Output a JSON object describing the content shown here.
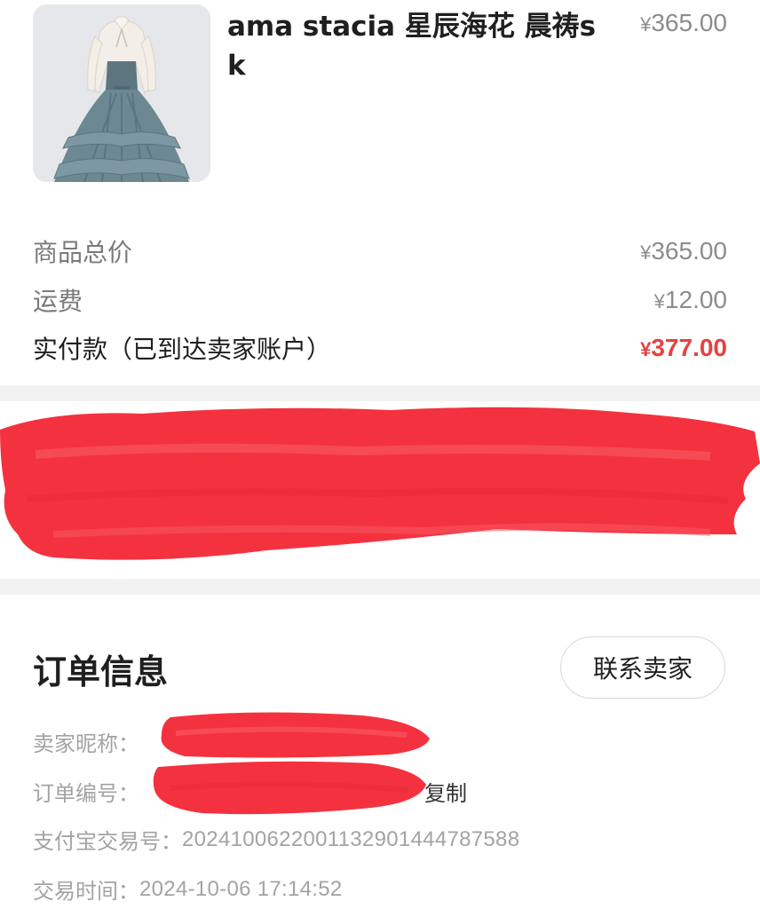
{
  "product": {
    "title": "ama stacia 星辰海花 晨祷sk",
    "price": "365.00",
    "currency": "¥",
    "image_icon": "dress-photo"
  },
  "summary": {
    "subtotal_label": "商品总价",
    "subtotal_value": "365.00",
    "shipping_label": "运费",
    "shipping_value": "12.00",
    "paid_label": "实付款（已到达卖家账户）",
    "paid_value": "377.00",
    "currency": "¥"
  },
  "order_info": {
    "title": "订单信息",
    "contact_button": "联系卖家",
    "seller_label": "卖家昵称：",
    "order_no_label": "订单编号：",
    "copy_label": "复制",
    "alipay_label": "支付宝交易号：",
    "alipay_value": "2024100622001132901444787588",
    "time_label": "交易时间：",
    "time_value": "2024-10-06 17:14:52"
  },
  "colors": {
    "accent_red": "#e8413e",
    "redaction": "#f4323f"
  }
}
